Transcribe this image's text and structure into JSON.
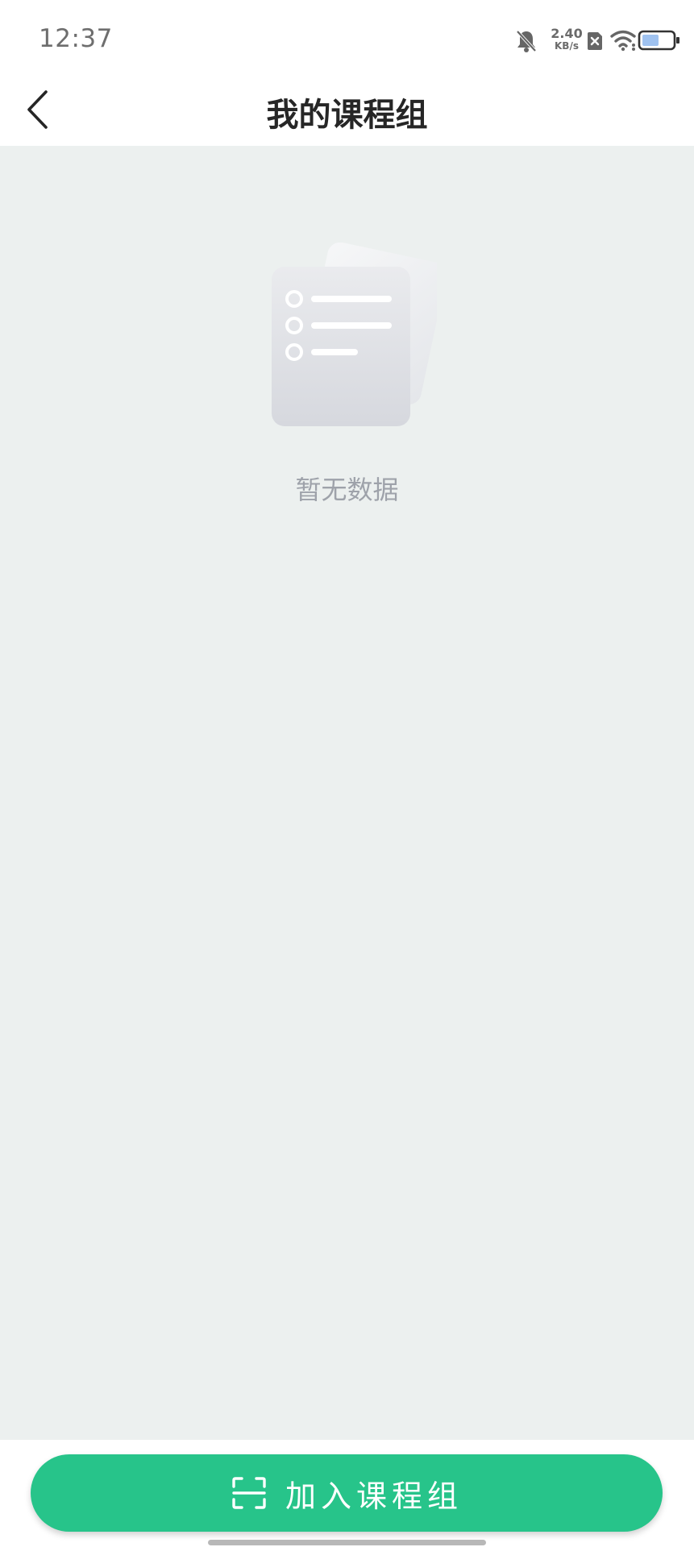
{
  "status_bar": {
    "time": "12:37",
    "net_speed_value": "2.40",
    "net_speed_unit": "KB/s",
    "icons": [
      "bell-muted-icon",
      "sim-off-icon",
      "wifi-icon",
      "battery-icon"
    ]
  },
  "header": {
    "title": "我的课程组",
    "back_icon": "chevron-left-icon"
  },
  "main": {
    "empty_illustration": "document-list-icon",
    "empty_text": "暂无数据"
  },
  "bottom": {
    "join_icon": "scan-icon",
    "join_label": "加入课程组"
  },
  "colors": {
    "accent": "#27c48a",
    "background": "#ecf0ef",
    "title_text": "#262626",
    "muted_text": "#9ea2aa"
  }
}
